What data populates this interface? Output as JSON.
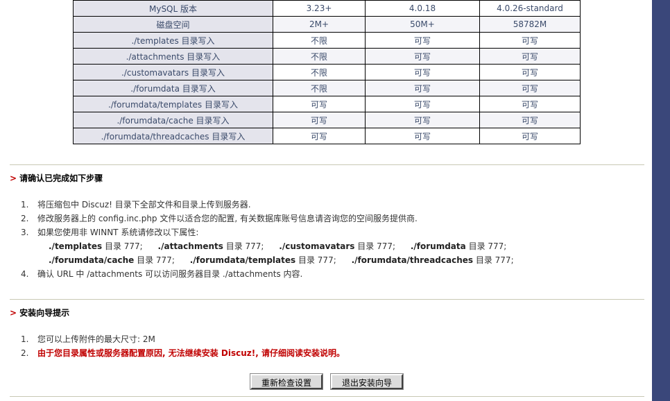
{
  "env_table": {
    "rows": [
      [
        "MySQL 版本",
        "3.23+",
        "4.0.18",
        "4.0.26-standard"
      ],
      [
        "磁盘空间",
        "2M+",
        "50M+",
        "58782M"
      ],
      [
        "./templates 目录写入",
        "不限",
        "可写",
        "可写"
      ],
      [
        "./attachments 目录写入",
        "不限",
        "可写",
        "可写"
      ],
      [
        "./customavatars 目录写入",
        "不限",
        "可写",
        "可写"
      ],
      [
        "./forumdata 目录写入",
        "不限",
        "可写",
        "可写"
      ],
      [
        "./forumdata/templates 目录写入",
        "可写",
        "可写",
        "可写"
      ],
      [
        "./forumdata/cache 目录写入",
        "可写",
        "可写",
        "可写"
      ],
      [
        "./forumdata/threadcaches 目录写入",
        "可写",
        "可写",
        "可写"
      ]
    ]
  },
  "confirm_section": {
    "marker": ">",
    "title": "请确认已完成如下步骤",
    "steps": [
      {
        "num": "1.",
        "text": "将压缩包中 Discuz! 目录下全部文件和目录上传到服务器."
      },
      {
        "num": "2.",
        "text": "修改服务器上的 config.inc.php 文件以适合您的配置, 有关数据库账号信息请咨询您的空间服务提供商."
      },
      {
        "num": "3.",
        "text": "如果您使用非 WINNT 系统请修改以下属性:"
      },
      {
        "num": "4.",
        "text": "确认 URL 中 /attachments 可以访问服务器目录 ./attachments 内容."
      }
    ],
    "attr_line1": [
      {
        "path": "./templates",
        "perm": " 目录 777;"
      },
      {
        "path": "./attachments",
        "perm": " 目录 777;"
      },
      {
        "path": "./customavatars",
        "perm": " 目录 777;"
      },
      {
        "path": "./forumdata",
        "perm": " 目录 777;"
      }
    ],
    "attr_line2": [
      {
        "path": "./forumdata/cache",
        "perm": " 目录 777;"
      },
      {
        "path": "./forumdata/templates",
        "perm": " 目录 777;"
      },
      {
        "path": "./forumdata/threadcaches",
        "perm": " 目录 777;"
      }
    ]
  },
  "tips_section": {
    "marker": ">",
    "title": "安装向导提示",
    "tips": [
      {
        "num": "1.",
        "text": "您可以上传附件的最大尺寸: 2M"
      },
      {
        "num": "2.",
        "text": "由于您目录属性或服务器配置原因, 无法继续安装 Discuz!, 请仔细阅读安装说明。"
      }
    ]
  },
  "buttons": {
    "recheck": "重新检查设置",
    "exit": "退出安装向导"
  },
  "colors": {
    "sidebar": "#3a477a",
    "error_text": "#c00000",
    "label_cell": "#e4e4ec"
  }
}
